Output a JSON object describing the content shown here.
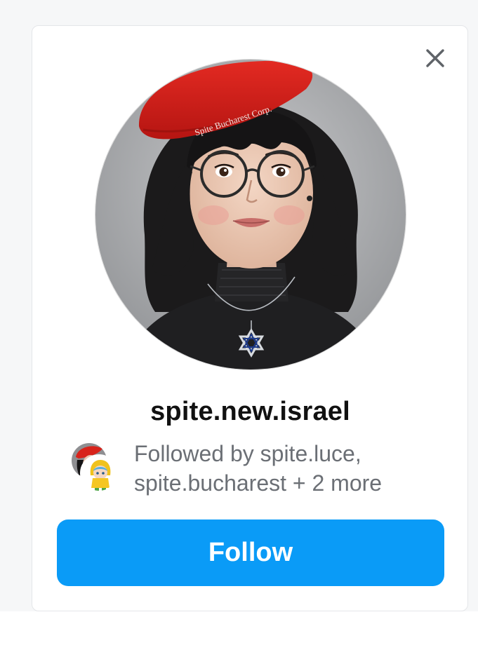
{
  "card": {
    "username": "spite.new.israel",
    "avatar_hat_text": "Spite Bucharest Corp.",
    "followed_by_line1": "Followed by spite.luce,",
    "followed_by_line2": "spite.bucharest + 2 more",
    "follow_label": "Follow",
    "close_icon": "close-icon"
  },
  "colors": {
    "accent": "#0a9bf7",
    "username_text": "#111111",
    "muted_text": "#6b6f75",
    "page_background": "#f6f7f8"
  }
}
